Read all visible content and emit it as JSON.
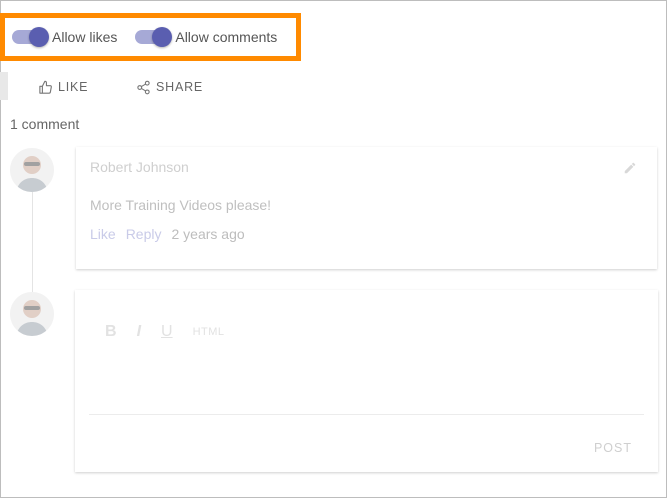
{
  "toggles": {
    "likes_label": "Allow likes",
    "comments_label": "Allow comments",
    "likes_on": true,
    "comments_on": true,
    "accent_color": "#5a5eb0",
    "highlight_color": "#ff8a00"
  },
  "actions": {
    "like_label": "LIKE",
    "share_label": "SHARE"
  },
  "comments": {
    "count_label": "1 comment",
    "items": [
      {
        "author": "Robert Johnson",
        "text": "More Training Videos please!",
        "like_label": "Like",
        "reply_label": "Reply",
        "time": "2 years ago"
      }
    ]
  },
  "editor": {
    "bold": "B",
    "italic": "I",
    "underline": "U",
    "html": "HTML",
    "post_label": "POST"
  }
}
